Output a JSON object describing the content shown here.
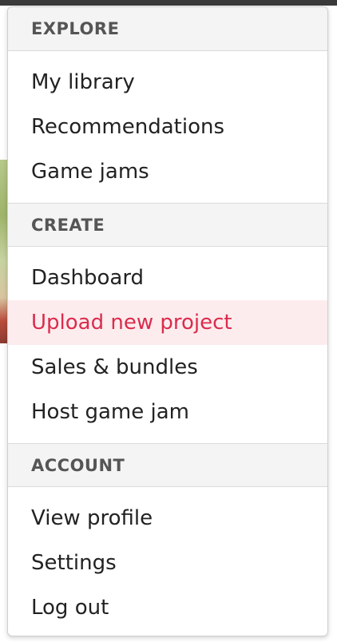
{
  "menu": {
    "sections": [
      {
        "header": "EXPLORE",
        "items": [
          "My library",
          "Recommendations",
          "Game jams"
        ]
      },
      {
        "header": "CREATE",
        "items": [
          "Dashboard",
          "Upload new project",
          "Sales & bundles",
          "Host game jam"
        ]
      },
      {
        "header": "ACCOUNT",
        "items": [
          "View profile",
          "Settings",
          "Log out"
        ]
      }
    ],
    "active_item": "Upload new project"
  },
  "colors": {
    "accent": "#da2c4d",
    "active_background": "#fdecee",
    "header_background": "#f4f4f4",
    "text": "#222222",
    "header_text": "#555555"
  }
}
